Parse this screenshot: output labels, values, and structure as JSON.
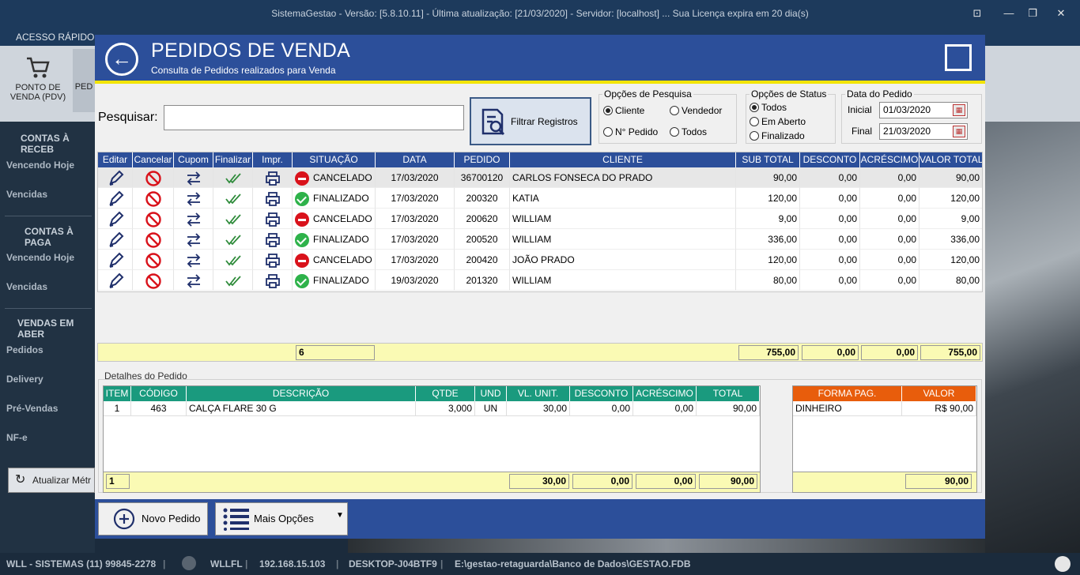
{
  "window": {
    "title": "SistemaGestao - Versão: [5.8.10.11] - Última atualização: [21/03/2020] - Servidor: [localhost] ... Sua Licença expira em 20 dia(s)",
    "controls": [
      "⊡",
      "—",
      "❐",
      "✕"
    ]
  },
  "menubar": {
    "first_item": "ACESSO RÁPIDO"
  },
  "ribbon": {
    "pdv_label_1": "PONTO DE",
    "pdv_label_2": "VENDA (PDV)",
    "second_label": "PED"
  },
  "sidebar": {
    "sections": [
      {
        "title": "CONTAS À RECEB",
        "items": [
          "Vencendo Hoje",
          "Vencidas"
        ]
      },
      {
        "title": "CONTAS À PAGA",
        "items": [
          "Vencendo Hoje",
          "Vencidas"
        ]
      },
      {
        "title": "VENDAS EM ABER",
        "items": [
          "Pedidos",
          "Delivery",
          "Pré-Vendas",
          "NF-e"
        ]
      }
    ],
    "refresh_label": "Atualizar Métr"
  },
  "statusbar": {
    "company": "WLL - SISTEMAS (11) 99845-2278",
    "user": "WLLFL",
    "ip": "192.168.15.103",
    "host": "DESKTOP-J04BTF9",
    "db": "E:\\gestao-retaguarda\\Banco de Dados\\GESTAO.FDB"
  },
  "modal": {
    "title": "PEDIDOS DE VENDA",
    "subtitle": "Consulta de Pedidos realizados para Venda",
    "search_label": "Pesquisar:",
    "search_value": "",
    "filter_button": "Filtrar Registros",
    "search_options": {
      "legend": "Opções de Pesquisa",
      "options": [
        "Cliente",
        "Vendedor",
        "N° Pedido",
        "Todos"
      ],
      "selected": "Cliente"
    },
    "status_options": {
      "legend": "Opções de Status",
      "options": [
        "Todos",
        "Em Aberto",
        "Finalizado"
      ],
      "selected": "Todos"
    },
    "date": {
      "legend": "Data do Pedido",
      "start_label": "Inicial",
      "start_value": "01/03/2020",
      "end_label": "Final",
      "end_value": "21/03/2020"
    },
    "orders_columns": [
      "Editar",
      "Cancelar",
      "Cupom",
      "Finalizar",
      "Impr.",
      "SITUAÇÃO",
      "DATA",
      "PEDIDO",
      "CLIENTE",
      "SUB TOTAL",
      "DESCONTO",
      "ACRÉSCIMO",
      "VALOR TOTAL"
    ],
    "orders": [
      {
        "status": "CANCELADO",
        "date": "17/03/2020",
        "order": "36700120",
        "client": "CARLOS FONSECA DO PRADO",
        "subtotal": "90,00",
        "discount": "0,00",
        "addition": "0,00",
        "total": "90,00"
      },
      {
        "status": "FINALIZADO",
        "date": "17/03/2020",
        "order": "200320",
        "client": "KATIA",
        "subtotal": "120,00",
        "discount": "0,00",
        "addition": "0,00",
        "total": "120,00"
      },
      {
        "status": "CANCELADO",
        "date": "17/03/2020",
        "order": "200620",
        "client": "WILLIAM",
        "subtotal": "9,00",
        "discount": "0,00",
        "addition": "0,00",
        "total": "9,00"
      },
      {
        "status": "FINALIZADO",
        "date": "17/03/2020",
        "order": "200520",
        "client": "WILLIAM",
        "subtotal": "336,00",
        "discount": "0,00",
        "addition": "0,00",
        "total": "336,00"
      },
      {
        "status": "CANCELADO",
        "date": "17/03/2020",
        "order": "200420",
        "client": "JOÃO PRADO",
        "subtotal": "120,00",
        "discount": "0,00",
        "addition": "0,00",
        "total": "120,00"
      },
      {
        "status": "FINALIZADO",
        "date": "19/03/2020",
        "order": "201320",
        "client": "WILLIAM",
        "subtotal": "80,00",
        "discount": "0,00",
        "addition": "0,00",
        "total": "80,00"
      }
    ],
    "orders_totals": {
      "count": "6",
      "subtotal": "755,00",
      "discount": "0,00",
      "addition": "0,00",
      "total": "755,00"
    },
    "details": {
      "label": "Detalhes do Pedido",
      "columns": [
        "ITEM",
        "CÓDIGO",
        "DESCRIÇÃO",
        "QTDE",
        "UND",
        "VL. UNIT.",
        "DESCONTO",
        "ACRÉSCIMO",
        "TOTAL"
      ],
      "items": [
        {
          "item": "1",
          "code": "463",
          "desc": "CALÇA FLARE 30 G",
          "qty": "3,000",
          "unit": "UN",
          "unit_price": "30,00",
          "discount": "0,00",
          "addition": "0,00",
          "total": "90,00"
        }
      ],
      "totals": {
        "count": "1",
        "unit_price": "30,00",
        "discount": "0,00",
        "addition": "0,00",
        "total": "90,00"
      }
    },
    "payments": {
      "columns": [
        "FORMA PAG.",
        "VALOR"
      ],
      "rows": [
        {
          "method": "DINHEIRO",
          "value": "R$ 90,00"
        }
      ],
      "total": "90,00"
    },
    "footer": {
      "new_order": "Novo Pedido",
      "more_options": "Mais Opções"
    }
  },
  "colors": {
    "header_blue": "#2c4f9a",
    "accent_yellow": "#f2e400",
    "details_green": "#1a9a7e",
    "payment_orange": "#e85d0c",
    "cancel_red": "#d9121b",
    "final_green": "#2eb24a"
  }
}
